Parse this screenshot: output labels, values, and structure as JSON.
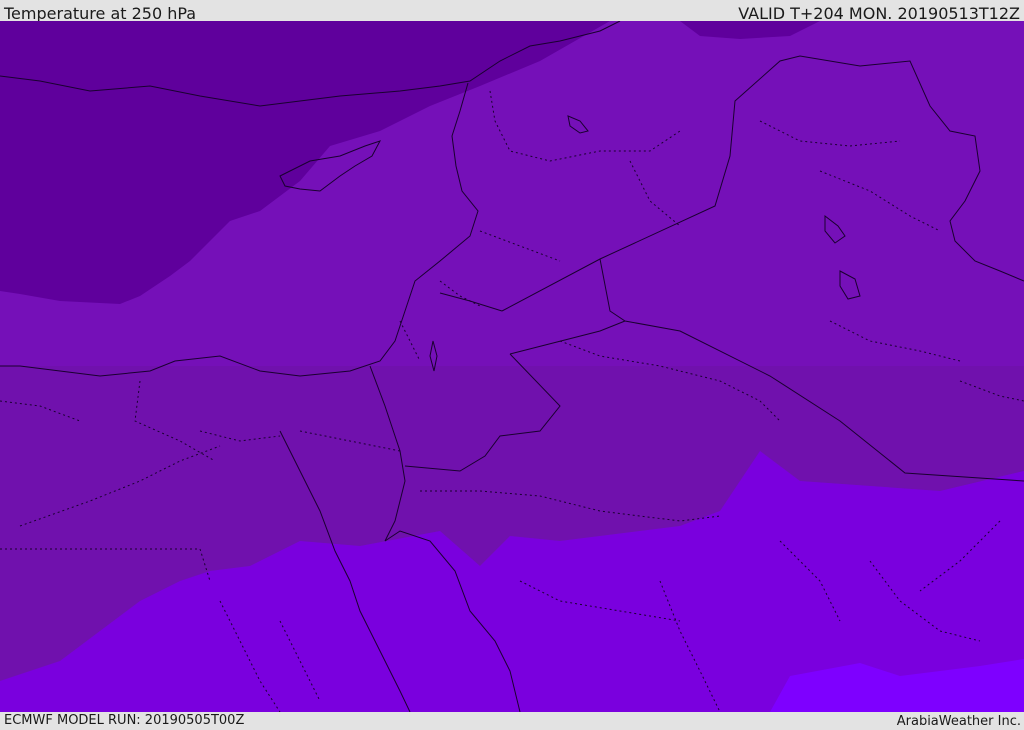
{
  "header": {
    "title": "Temperature at 250 hPa",
    "valid": "VALID T+204 MON. 20190513T12Z"
  },
  "footer": {
    "model_run": "ECMWF MODEL RUN: 20190505T00Z",
    "credit": "ArabiaWeather Inc."
  },
  "map": {
    "field": "temperature",
    "level": "250 hPa",
    "colors": {
      "coldest_band": "#5f009c",
      "cold_band": "#7510b8",
      "mid_band": "#7011ad",
      "warm_band": "#7a00de",
      "warmest_band": "#7e00ff",
      "borders": "#1a0030"
    }
  }
}
